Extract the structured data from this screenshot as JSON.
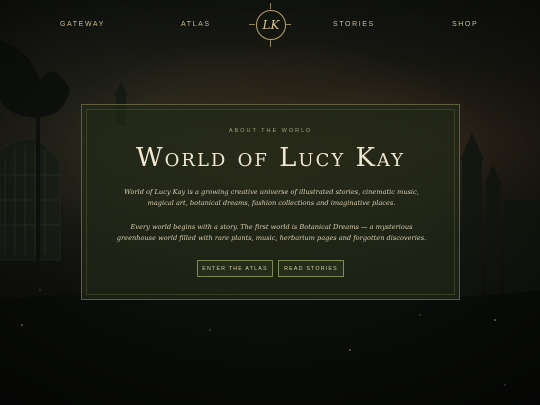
{
  "nav": {
    "items": [
      {
        "label": "GATEWAY"
      },
      {
        "label": "ATLAS"
      },
      {
        "label": "STORIES"
      },
      {
        "label": "SHOP"
      }
    ],
    "logo_text": "LK"
  },
  "hero": {
    "eyebrow": "ABOUT THE WORLD",
    "title": "World of Lucy Kay",
    "paragraph_1": "World of Lucy Kay is a growing creative universe of illustrated stories, cinematic music, magical art, botanical dreams, fashion collections and imaginative places.",
    "paragraph_2": "Every world begins with a story. The first world is Botanical Dreams — a mysterious greenhouse world filled with rare plants, music, herbarium pages and forgotten discoveries.",
    "buttons": [
      {
        "label": "ENTER THE ATLAS"
      },
      {
        "label": "READ STORIES"
      }
    ]
  },
  "colors": {
    "accent_gold": "#c9bd94",
    "panel_bg": "#202818",
    "button_border": "#7d8a55"
  }
}
